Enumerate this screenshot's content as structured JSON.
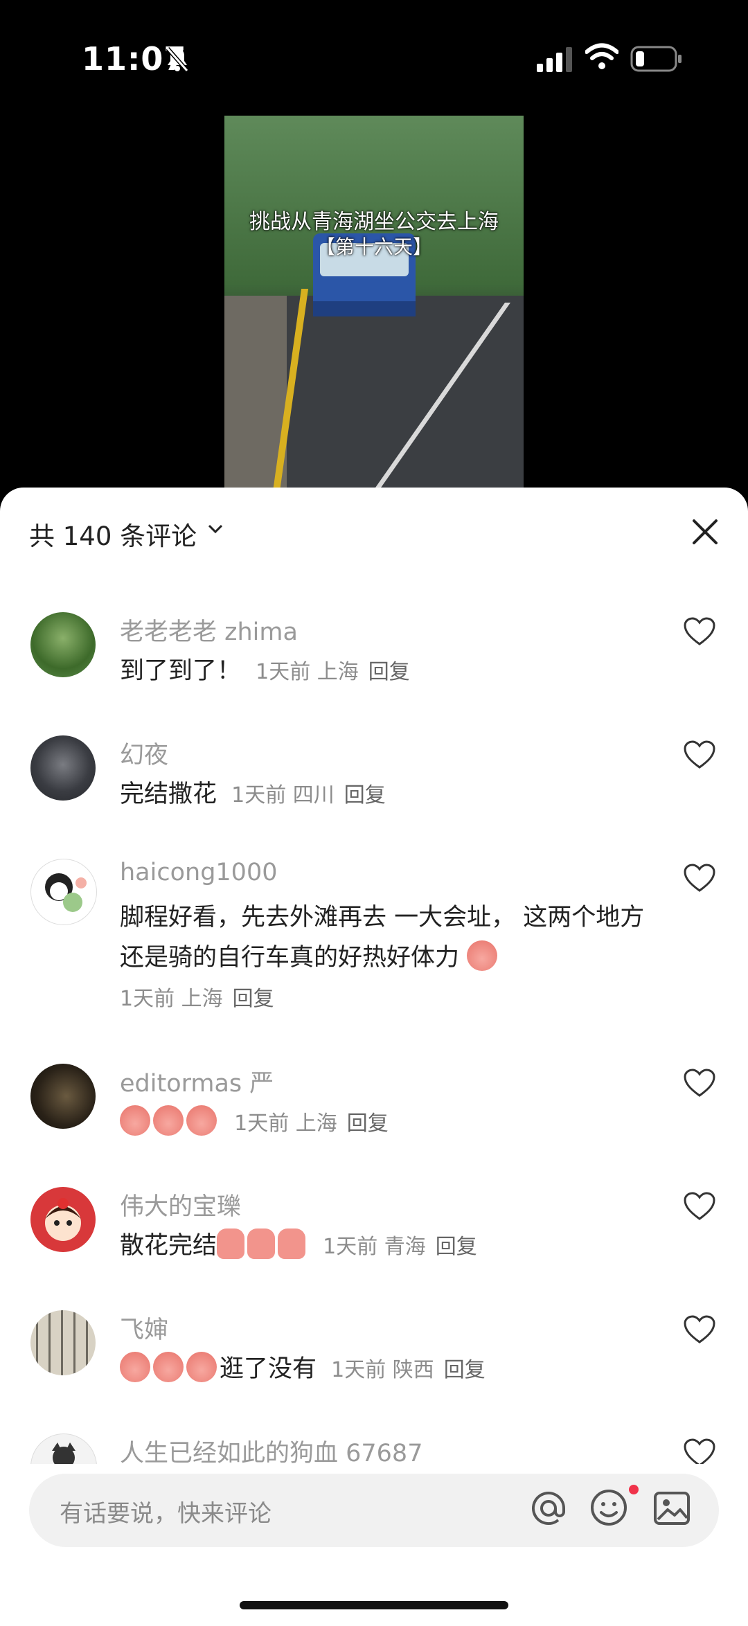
{
  "status_bar": {
    "time": "11:07"
  },
  "video": {
    "caption_line1": "挑战从青海湖坐公交去上海",
    "caption_line2": "【第十六天】"
  },
  "comments_header": {
    "title": "共 140 条评论"
  },
  "comments": [
    {
      "user": "老老老老 zhima",
      "text": "到了到了！",
      "time": "1天前",
      "location": "上海",
      "reply": "回复"
    },
    {
      "user": "幻夜",
      "text": "完结撒花",
      "time": "1天前",
      "location": "四川",
      "reply": "回复"
    },
    {
      "user": "haicong1000",
      "text": "脚程好看，先去外滩再去 一大会址， 这两个地方还是骑的自行车真的好热好体力",
      "time": "1天前",
      "location": "上海",
      "reply": "回复"
    },
    {
      "user": "editormas 严",
      "text": "",
      "time": "1天前",
      "location": "上海",
      "reply": "回复"
    },
    {
      "user": "伟大的宝瓅",
      "text": "散花完结",
      "time": "1天前",
      "location": "青海",
      "reply": "回复"
    },
    {
      "user": "飞婶",
      "text": "逛了没有",
      "time": "1天前",
      "location": "陕西",
      "reply": "回复"
    },
    {
      "user": "人生已经如此的狗血 67687"
    }
  ],
  "input": {
    "placeholder": "有话要说，快来评论"
  },
  "colors": {
    "accent_dot": "#f0334a",
    "username": "#9a9a9a"
  }
}
